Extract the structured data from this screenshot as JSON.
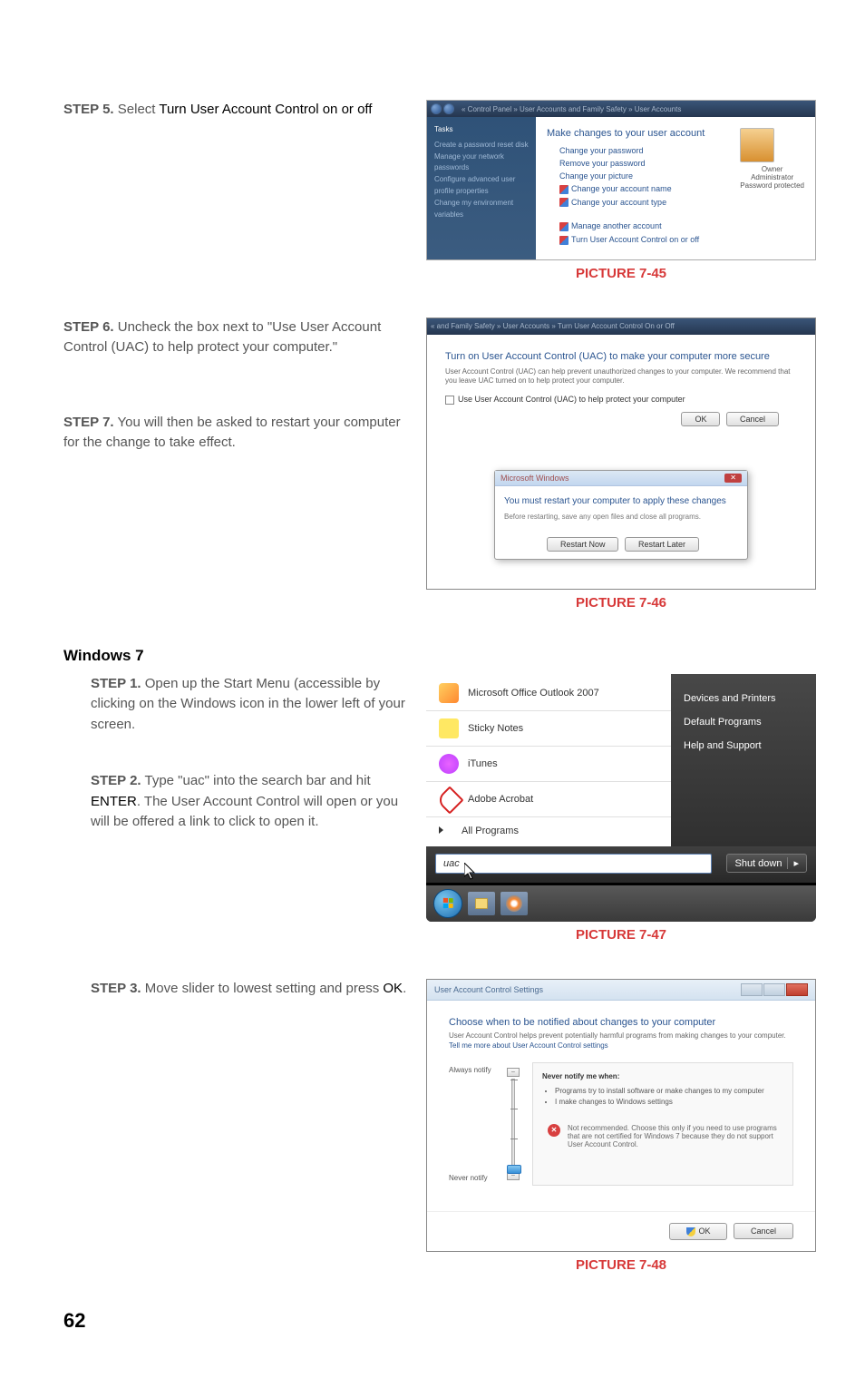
{
  "step5": {
    "label": "STEP 5.",
    "text_prefix": " Select ",
    "text_bold": "Turn User Account Control on or off"
  },
  "step6": {
    "label": "STEP 6.",
    "text": " Uncheck the box next to \"Use User Account Control (UAC) to help protect your computer.\""
  },
  "step7": {
    "label": "STEP 7.",
    "text": " You will then be asked to restart your computer for the change to take effect."
  },
  "windows7_heading": "Windows 7",
  "step1": {
    "label": "STEP 1.",
    "text": " Open up the Start Menu (accessible by clicking on the Windows icon in the lower left of your screen."
  },
  "step2": {
    "label": "STEP 2.",
    "text_a": " Type \"uac\" into the search bar and hit ",
    "enter": "ENTER",
    "text_b": ". The User Account Control will open or you will be offered a link to click to open it."
  },
  "step3": {
    "label": "STEP 3.",
    "text_a": " Move slider to lowest setting and press ",
    "ok": "OK",
    "text_b": "."
  },
  "picture_45": "PICTURE 7-45",
  "picture_46": "PICTURE 7-46",
  "picture_47": "PICTURE 7-47",
  "picture_48": "PICTURE 7-48",
  "page_number": "62",
  "vista_accounts": {
    "breadcrumb": "« Control Panel » User Accounts and Family Safety » User Accounts",
    "sidebar_tasks": "Tasks",
    "sidebar_items": [
      "Create a password reset disk",
      "Manage your network passwords",
      "Configure advanced user profile properties",
      "Change my environment variables"
    ],
    "main_heading": "Make changes to your user account",
    "links": [
      "Change your password",
      "Remove your password",
      "Change your picture",
      "Change your account name",
      "Change your account type"
    ],
    "links2": [
      "Manage another account",
      "Turn User Account Control on or off"
    ],
    "user_name": "Owner",
    "user_type": "Administrator",
    "user_protected": "Password protected"
  },
  "uac_onoff": {
    "breadcrumb": "« and Family Safety » User Accounts » Turn User Account Control On or Off",
    "heading": "Turn on User Account Control (UAC) to make your computer more secure",
    "desc": "User Account Control (UAC) can help prevent unauthorized changes to your computer. We recommend that you leave UAC turned on to help protect your computer.",
    "checkbox_label": "Use User Account Control (UAC) to help protect your computer",
    "ok": "OK",
    "cancel": "Cancel"
  },
  "restart": {
    "title": "Microsoft Windows",
    "msg": "You must restart your computer to apply these changes",
    "sub": "Before restarting, save any open files and close all programs.",
    "btn_now": "Restart Now",
    "btn_later": "Restart Later"
  },
  "start_menu": {
    "items": [
      "Microsoft Office Outlook 2007",
      "Sticky Notes",
      "iTunes",
      "Adobe Acrobat"
    ],
    "all_programs": "All Programs",
    "right_items": [
      "Devices and Printers",
      "Default Programs",
      "Help and Support"
    ],
    "search_value": "uac",
    "shutdown": "Shut down"
  },
  "uac_slider": {
    "title": "User Account Control Settings",
    "heading": "Choose when to be notified about changes to your computer",
    "desc": "User Account Control helps prevent potentially harmful programs from making changes to your computer.",
    "link": "Tell me more about User Account Control settings",
    "label_top": "Always notify",
    "label_bottom": "Never notify",
    "info_title": "Never notify me when:",
    "info_items": [
      "Programs try to install software or make changes to my computer",
      "I make changes to Windows settings"
    ],
    "warning": "Not recommended. Choose this only if you need to use programs that are not certified for Windows 7 because they do not support User Account Control.",
    "ok": "OK",
    "cancel": "Cancel"
  }
}
